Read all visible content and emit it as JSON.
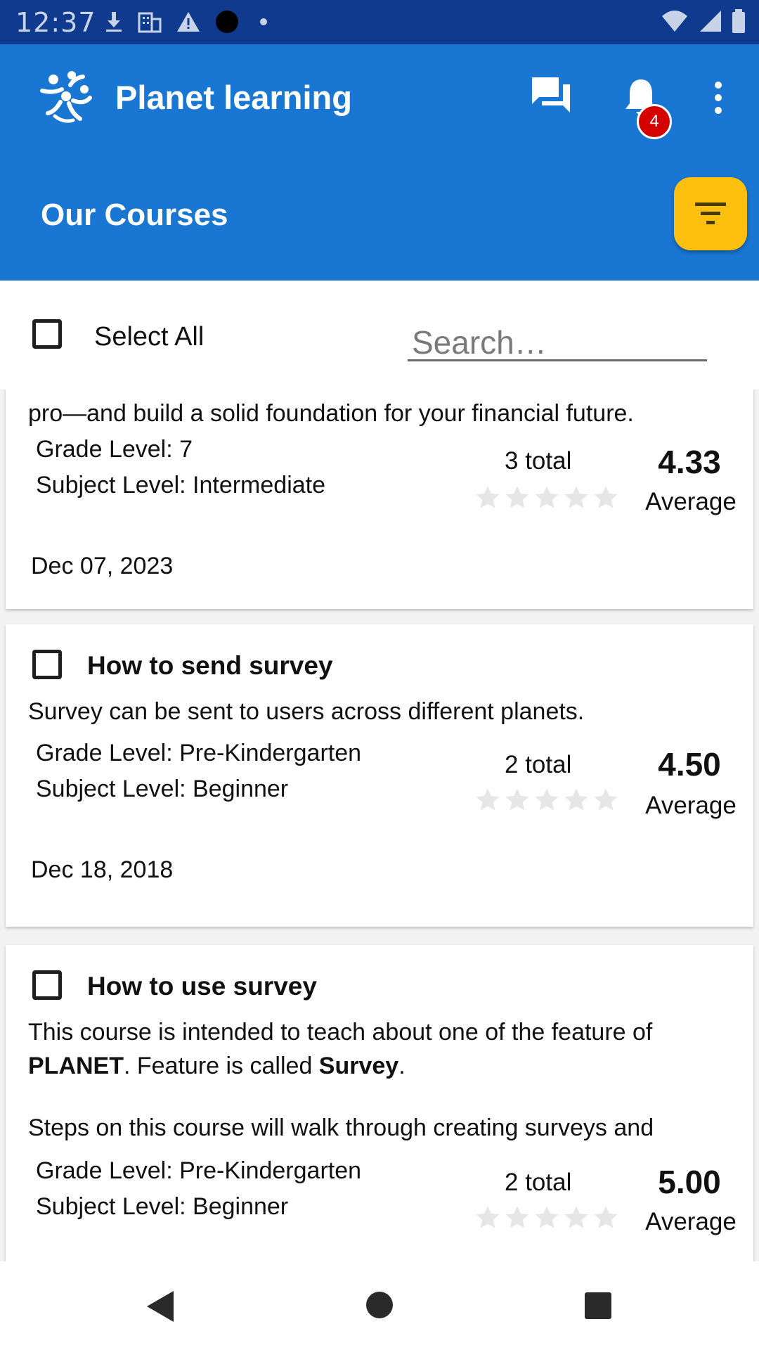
{
  "status_bar": {
    "time": "12:37"
  },
  "app_bar": {
    "title": "Planet learning",
    "notification_count": "4",
    "page_title": "Our Courses"
  },
  "toolbar": {
    "select_all_label": "Select All",
    "search_placeholder": "Search…"
  },
  "courses": [
    {
      "title": "",
      "description_visible": "pro—and build a solid foundation for your financial future.",
      "grade_level": "Grade Level: 7",
      "subject_level": "Subject Level: Intermediate",
      "total": "3 total",
      "average": "4.33",
      "average_label": "Average",
      "date": "Dec 07, 2023"
    },
    {
      "title": "How to send survey",
      "description": "Survey can be sent to users across different planets.",
      "grade_level": "Grade Level: Pre-Kindergarten",
      "subject_level": "Subject Level: Beginner",
      "total": "2 total",
      "average": "4.50",
      "average_label": "Average",
      "date": "Dec 18, 2018"
    },
    {
      "title": "How to use survey",
      "description_p1_a": "This course is intended to teach about one of the feature of ",
      "description_p1_b": "PLANET",
      "description_p1_c": ". Feature is called ",
      "description_p1_d": "Survey",
      "description_p1_e": ".",
      "description_p2": "Steps on this course will walk through creating surveys and",
      "grade_level": "Grade Level: Pre-Kindergarten",
      "subject_level": "Subject Level: Beginner",
      "total": "2 total",
      "average": "5.00",
      "average_label": "Average"
    }
  ],
  "icons": {
    "chat": "chat-icon",
    "notifications": "bell-icon",
    "overflow": "more-vert-icon",
    "filter": "filter-icon",
    "back": "back-icon",
    "home": "home-icon",
    "recents": "recents-icon"
  },
  "colors": {
    "primary": "#1976d2",
    "status_bar": "#0f3a8d",
    "accent": "#fdc00f",
    "badge": "#d50000",
    "star_empty": "#e6e6e6"
  }
}
